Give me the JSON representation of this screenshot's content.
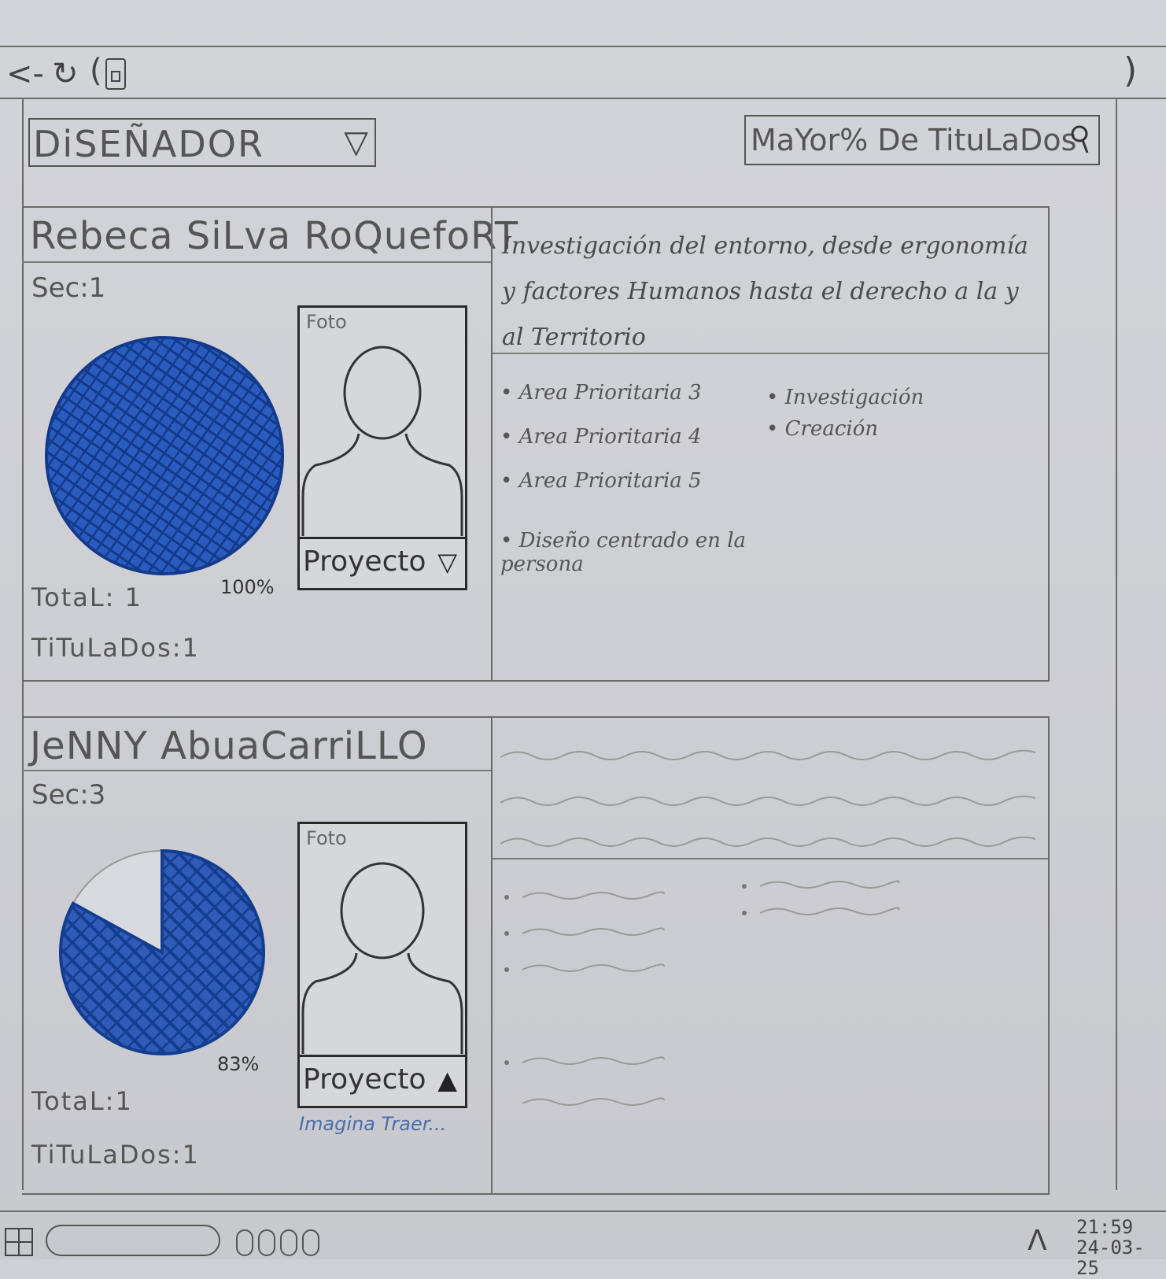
{
  "browser": {
    "back_icon": "back-arrow-icon",
    "reload_icon": "reload-icon",
    "lock_icon": "lock-icon"
  },
  "filters": {
    "role_select_value": "DiSEÑADOR",
    "search_value": "MaYor% De TituLaDos"
  },
  "cards": [
    {
      "name": "Rebeca SiLva RoQuefoRT",
      "sec": "Sec:1",
      "percent_label": "100%",
      "percent": 100,
      "total": "TotaL: 1",
      "titulados": "TiTuLaDos:1",
      "photo_label": "Foto",
      "project_label": "Proyecto",
      "description": "Investigación del entorno, desde ergonomía y factores Humanos hasta el derecho a la y al Territorio",
      "bullets_left": [
        "Area Prioritaria 3",
        "Area Prioritaria 4",
        "Area Prioritaria 5",
        "Diseño centrado en la persona"
      ],
      "bullets_right": [
        "Investigación",
        "Creación"
      ]
    },
    {
      "name": "JeNNY AbuaCarriLLO",
      "sec": "Sec:3",
      "percent_label": "83%",
      "percent": 83,
      "total": "TotaL:1",
      "titulados": "TiTuLaDos:1",
      "photo_label": "Foto",
      "project_label": "Proyecto",
      "image_link": "Imagina Traer..."
    }
  ],
  "taskbar": {
    "time": "21:59",
    "date": "24-03-25"
  },
  "colors": {
    "pie_fill": "#1f4fa8",
    "pie_rest": "#d9dadf"
  }
}
